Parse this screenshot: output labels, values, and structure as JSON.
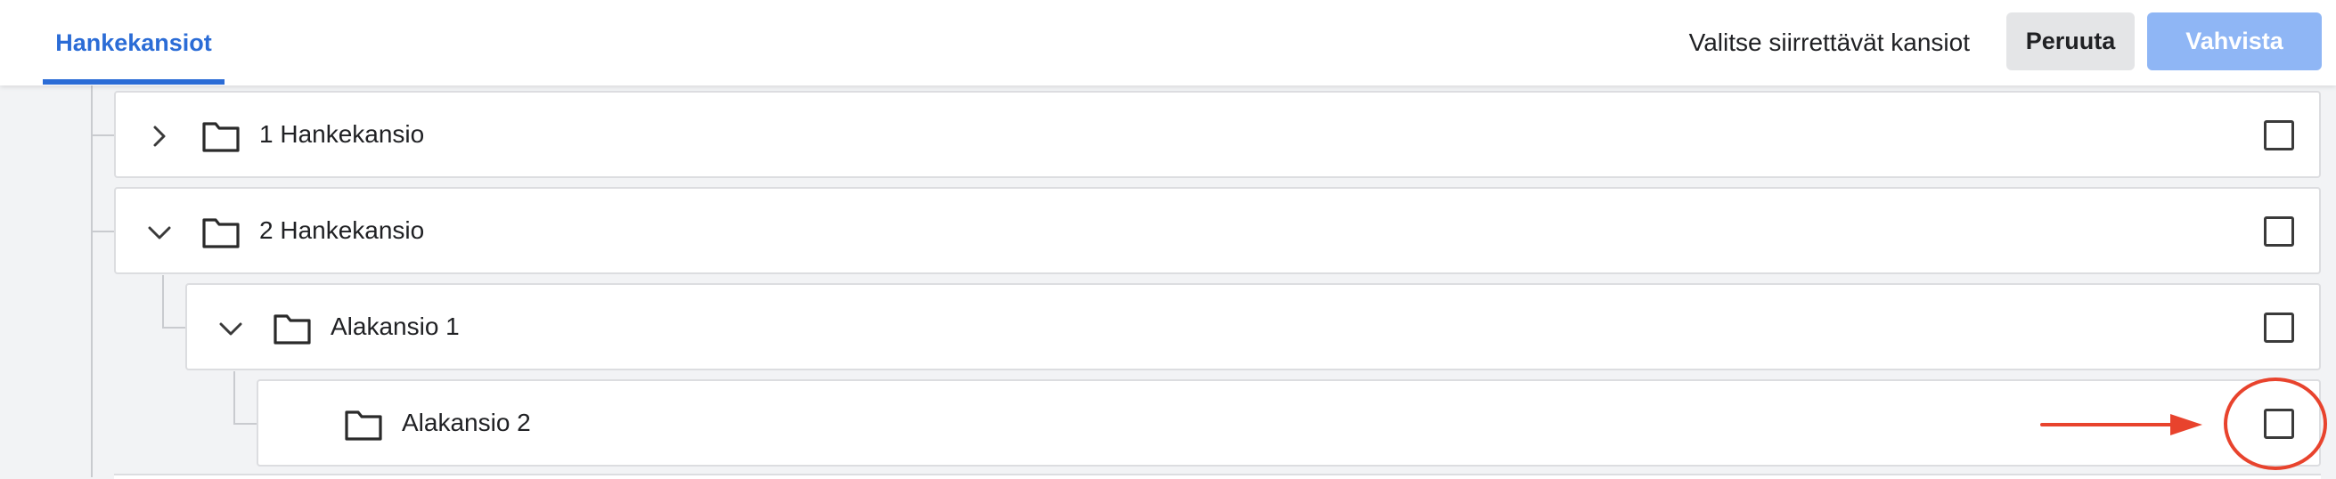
{
  "header": {
    "tab_label": "Hankekansiot",
    "instruction": "Valitse siirrettävät kansiot",
    "cancel_label": "Peruuta",
    "confirm_label": "Vahvista"
  },
  "tree": {
    "rows": [
      {
        "label": "1 Hankekansio",
        "expanded": false,
        "has_children": true,
        "checked": false
      },
      {
        "label": "2 Hankekansio",
        "expanded": true,
        "has_children": true,
        "checked": false
      },
      {
        "label": "Alakansio 1",
        "expanded": true,
        "has_children": true,
        "checked": false
      },
      {
        "label": "Alakansio 2",
        "has_children": false,
        "checked": false
      }
    ]
  },
  "icons": {
    "folder": "folder-icon",
    "chevron_right": "chevron-right-icon",
    "chevron_down": "chevron-down-icon",
    "checkbox": "checkbox-icon"
  },
  "colors": {
    "accent": "#2b6cd6",
    "confirm_disabled": "#8fb6f5",
    "cancel_bg": "#e4e5e7",
    "annotation": "#e8432d",
    "border": "#dcdde0"
  }
}
